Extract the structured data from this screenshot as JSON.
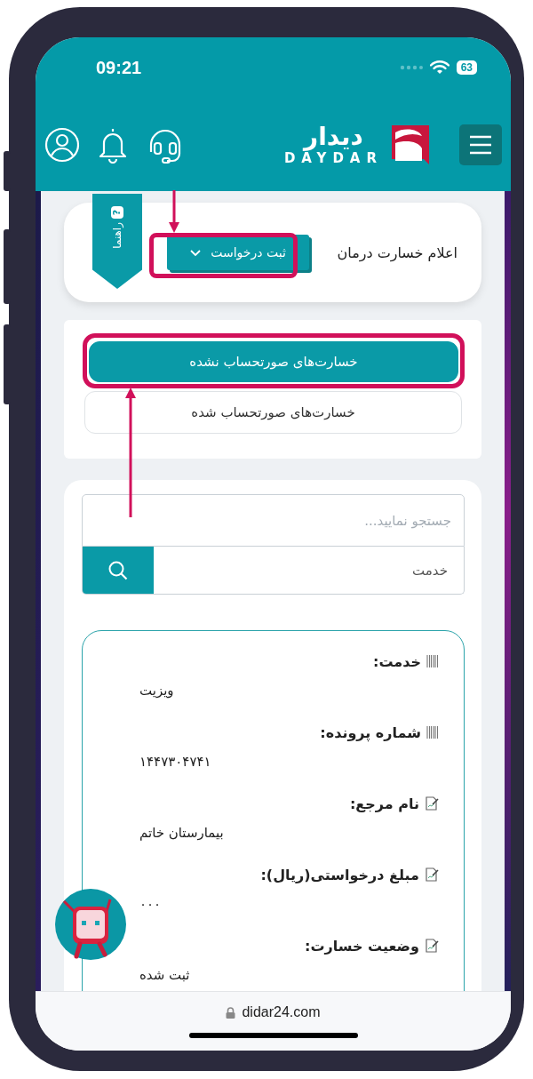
{
  "status_bar": {
    "time": "09:21",
    "battery": "63"
  },
  "header": {
    "logo_persian": "دیدار",
    "logo_latin": "DAYDAR"
  },
  "page": {
    "title": "اعلام خسارت درمان",
    "action_dropdown": "ثبت درخواست",
    "guide": {
      "badge": "?",
      "label": "راهنما"
    }
  },
  "tabs": [
    {
      "label": "خسارت‌های صورتحساب نشده",
      "selected": true
    },
    {
      "label": "خسارت‌های صورتحساب شده",
      "selected": false
    }
  ],
  "search": {
    "placeholder": "جستجو نمایید...",
    "filter": "خدمت"
  },
  "record": [
    {
      "kind": "barcode",
      "label": "خدمت:",
      "value": "ویزیت"
    },
    {
      "kind": "barcode",
      "label": "شماره پرونده:",
      "value": "۱۴۴۷۳۰۴۷۴۱"
    },
    {
      "kind": "document",
      "label": "نام مرجع:",
      "value": "بیمارستان خاتم"
    },
    {
      "kind": "document",
      "label": "مبلغ درخواستی(ریال):",
      "value": "۰۰۰"
    },
    {
      "kind": "document",
      "label": "وضعیت خسارت:",
      "value": "ثبت شده"
    }
  ],
  "browser": {
    "url": "didar24.com"
  }
}
